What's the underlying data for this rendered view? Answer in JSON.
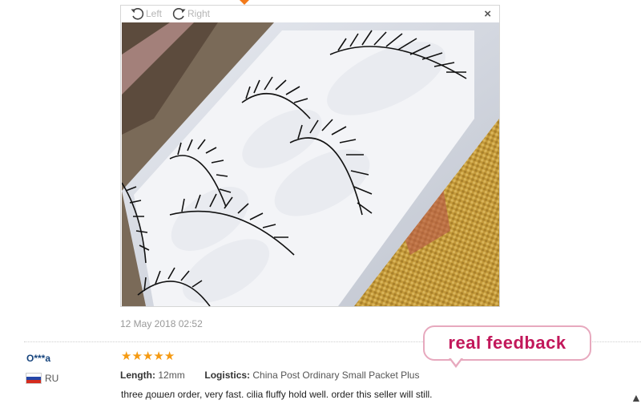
{
  "viewer": {
    "rotate_left_label": "Left",
    "rotate_right_label": "Right",
    "close_label": "×",
    "rotate_left_icon": "rotate-left-icon",
    "rotate_right_icon": "rotate-right-icon",
    "close_icon": "close-icon"
  },
  "review": {
    "date": "12 May 2018 02:52",
    "reviewer": "O***a",
    "country_code": "RU",
    "flag_colors": [
      "#ffffff",
      "#2446a8",
      "#d52b1e"
    ],
    "stars": 5,
    "star_glyph": "★",
    "length_label": "Length:",
    "length_value": "12mm",
    "logistics_label": "Logistics:",
    "logistics_value": "China Post Ordinary Small Packet Plus",
    "text": "three дошел order, very fast. cilia fluffy hold well. order this seller will still."
  },
  "sticker": {
    "text": "real feedback",
    "color": "#c2185b",
    "border_color": "#e7a9be"
  },
  "accent_color": "#f27a1a"
}
